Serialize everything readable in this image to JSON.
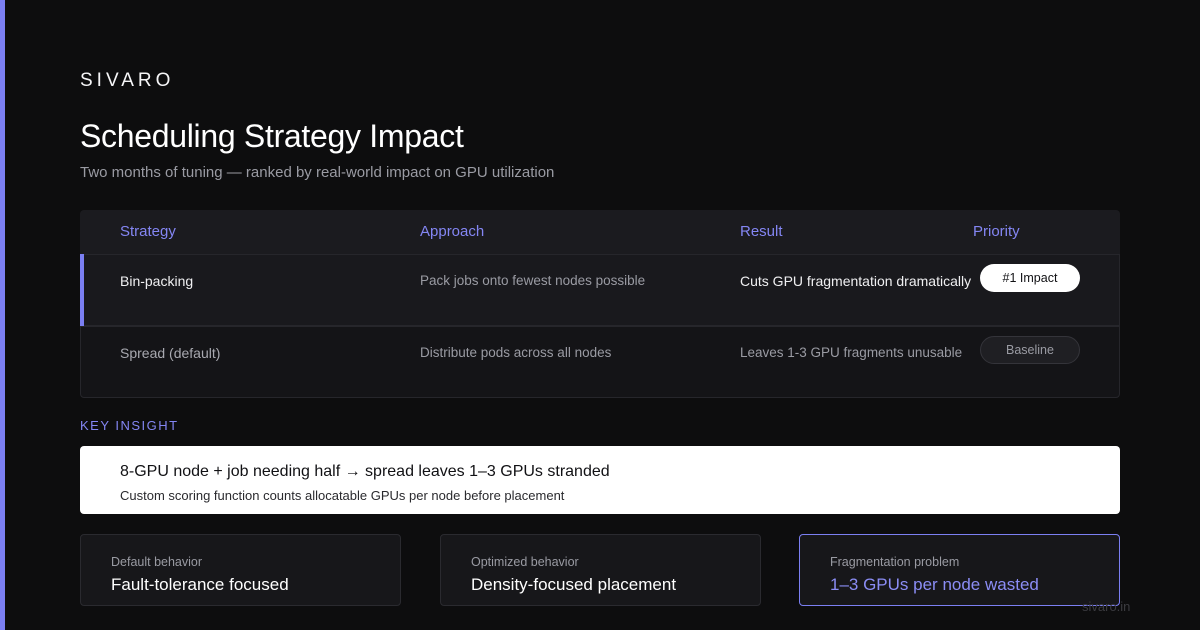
{
  "brand": "SIVARO",
  "title": "Scheduling Strategy Impact",
  "subtitle": "Two months of tuning — ranked by real-world impact on GPU utilization",
  "table": {
    "headers": [
      "Strategy",
      "Approach",
      "Result",
      "Priority"
    ],
    "rows": [
      {
        "strategy": "Bin-packing",
        "approach": "Pack jobs onto fewest nodes possible",
        "result": "Cuts GPU fragmentation dramatically",
        "priority": "#1 Impact"
      },
      {
        "strategy": "Spread (default)",
        "approach": "Distribute pods across all nodes",
        "result": "Leaves 1-3 GPU fragments unusable",
        "priority": "Baseline"
      }
    ]
  },
  "insight": {
    "label": "KEY INSIGHT",
    "headline": "8-GPU node + job needing half → spread leaves 1–3 GPUs stranded",
    "body": "Custom scoring function counts allocatable GPUs per node before placement"
  },
  "cards": [
    {
      "label": "Default behavior",
      "value": "Fault-tolerance focused"
    },
    {
      "label": "Optimized behavior",
      "value": "Density-focused placement"
    },
    {
      "label": "Fragmentation problem",
      "value": "1–3 GPUs per node wasted"
    }
  ],
  "footer": "sivaro.in",
  "colors": {
    "accent": "#7b7ff2",
    "background": "#0d0d0e"
  }
}
